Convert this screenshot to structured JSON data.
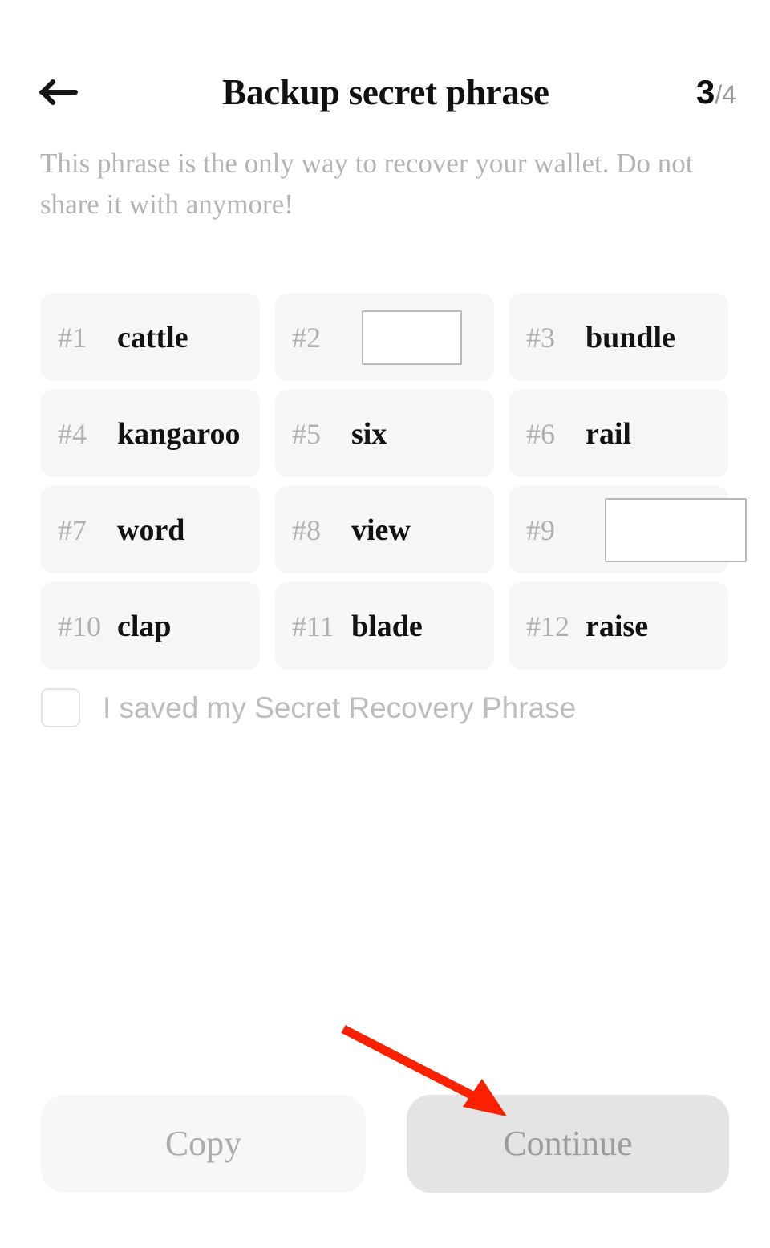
{
  "header": {
    "back_icon": "arrow-left-icon",
    "title": "Backup secret phrase",
    "step_current": "3",
    "step_total": "/4"
  },
  "description": "This phrase is the only way to recover your wallet. Do not share it with anymore!",
  "seed_phrase": {
    "words": [
      {
        "index": "#1",
        "word": "cattle",
        "editable": false,
        "value": ""
      },
      {
        "index": "#2",
        "word": "",
        "editable": true,
        "value": "",
        "size": "small"
      },
      {
        "index": "#3",
        "word": "bundle",
        "editable": false,
        "value": ""
      },
      {
        "index": "#4",
        "word": "kangaroo",
        "editable": false,
        "value": ""
      },
      {
        "index": "#5",
        "word": "six",
        "editable": false,
        "value": ""
      },
      {
        "index": "#6",
        "word": "rail",
        "editable": false,
        "value": ""
      },
      {
        "index": "#7",
        "word": "word",
        "editable": false,
        "value": ""
      },
      {
        "index": "#8",
        "word": "view",
        "editable": false,
        "value": ""
      },
      {
        "index": "#9",
        "word": "",
        "editable": true,
        "value": "",
        "size": "large"
      },
      {
        "index": "#10",
        "word": "clap",
        "editable": false,
        "value": ""
      },
      {
        "index": "#11",
        "word": "blade",
        "editable": false,
        "value": ""
      },
      {
        "index": "#12",
        "word": "raise",
        "editable": false,
        "value": ""
      }
    ]
  },
  "confirm": {
    "checked": false,
    "label": "I saved my Secret Recovery Phrase"
  },
  "footer": {
    "copy_label": "Copy",
    "continue_label": "Continue"
  },
  "annotation": {
    "arrow_color": "#FA2000",
    "target": "continue-button"
  },
  "colors": {
    "page_background": "#FFFFFF",
    "card_background": "#F6F6F6",
    "title_text": "#111111",
    "muted_text": "#B4B4B4",
    "continue_background": "#E4E4E4",
    "copy_background": "#F7F7F7",
    "annotation_red": "#FA2000"
  }
}
